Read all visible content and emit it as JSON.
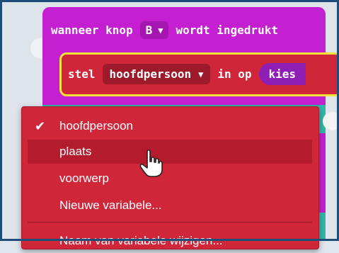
{
  "event": {
    "prefix": "wanneer knop",
    "button_value": "B",
    "suffix": "wordt ingedrukt"
  },
  "statement": {
    "prefix": "stel",
    "variable": "hoofdpersoon",
    "middle": "in op",
    "value_block": "kies"
  },
  "menu": {
    "items": [
      {
        "label": "hoofdpersoon",
        "checked": true
      },
      {
        "label": "plaats",
        "hovered": true
      },
      {
        "label": "voorwerp"
      },
      {
        "label": "Nieuwe variabele..."
      },
      {
        "label": "Naam van variabele wijzigen..."
      }
    ]
  },
  "colors": {
    "event_block": "#c41fd1",
    "statement_block": "#d0263a",
    "menu_bg": "#d0263a",
    "highlight_border": "#f1e23a",
    "teal": "#2fb7a8"
  },
  "icons": {
    "checkmark": "check-icon",
    "caret": "chevron-down-icon",
    "cursor": "hand-pointer-icon"
  }
}
